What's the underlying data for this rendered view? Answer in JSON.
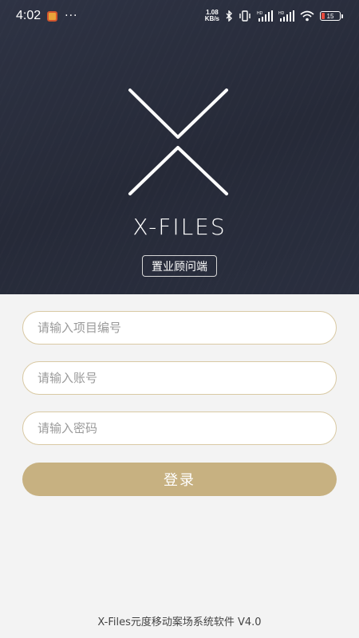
{
  "status_bar": {
    "time": "4:02",
    "dots": "···",
    "net_speed_value": "1.08",
    "net_speed_unit": "KB/s",
    "battery_level": "15",
    "icons": [
      "app-notification-icon",
      "bluetooth-icon",
      "vibrate-icon",
      "hd-signal-icon",
      "hd-signal-icon",
      "wifi-icon",
      "battery-icon"
    ]
  },
  "hero": {
    "brand": "X-FILES",
    "role_badge": "置业顾问端"
  },
  "form": {
    "project_placeholder": "请输入项目编号",
    "account_placeholder": "请输入账号",
    "password_placeholder": "请输入密码",
    "login_label": "登录"
  },
  "footer": {
    "text": "X-Files元度移动案场系统软件 V4.0"
  },
  "colors": {
    "hero_bg": "#2a2f3f",
    "accent_gold": "#c7b181",
    "field_border": "#d9c9a3",
    "page_bg": "#f3f3f3"
  }
}
